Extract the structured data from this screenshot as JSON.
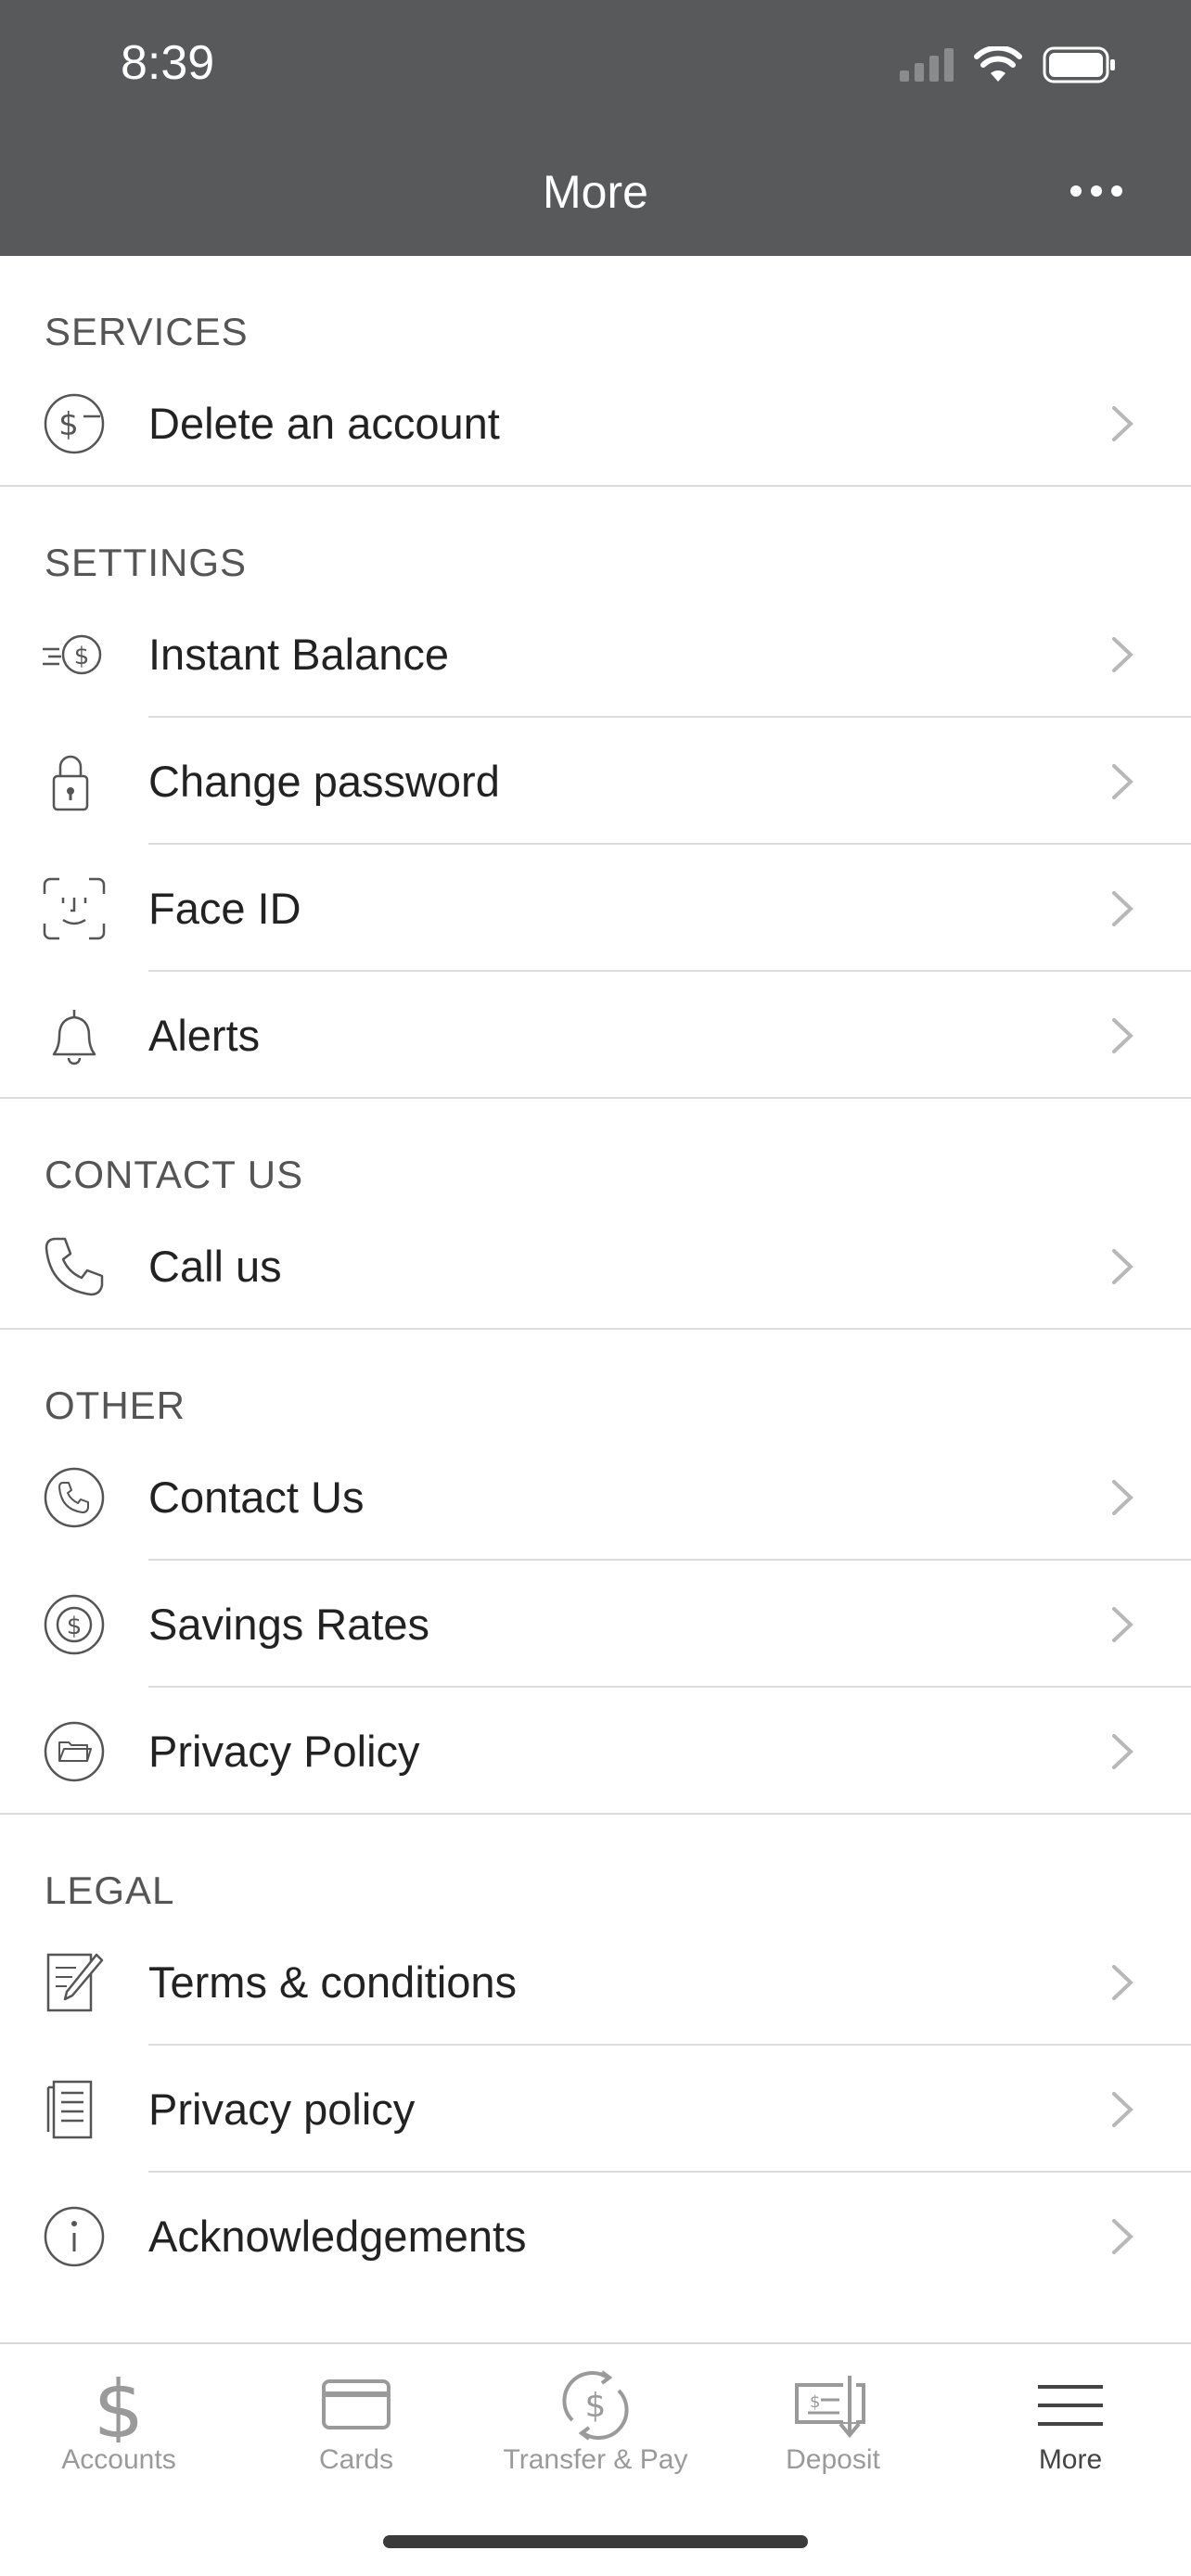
{
  "status_bar": {
    "time": "8:39"
  },
  "nav": {
    "title": "More",
    "more_icon": "ellipsis-icon"
  },
  "sections": {
    "services": {
      "header": "SERVICES",
      "items": [
        {
          "label": "Delete an account",
          "icon": "dollar-minus-icon"
        }
      ]
    },
    "settings": {
      "header": "SETTINGS",
      "items": [
        {
          "label": "Instant Balance",
          "icon": "fast-dollar-icon"
        },
        {
          "label": "Change password",
          "icon": "lock-icon"
        },
        {
          "label": "Face ID",
          "icon": "face-id-icon"
        },
        {
          "label": "Alerts",
          "icon": "bell-icon"
        }
      ]
    },
    "contact": {
      "header": "CONTACT US",
      "items": [
        {
          "label": "Call us",
          "icon": "phone-icon"
        }
      ]
    },
    "other": {
      "header": "OTHER",
      "items": [
        {
          "label": "Contact Us",
          "icon": "phone-circle-icon"
        },
        {
          "label": "Savings Rates",
          "icon": "dollar-circle-icon"
        },
        {
          "label": "Privacy Policy",
          "icon": "folder-circle-icon"
        }
      ]
    },
    "legal": {
      "header": "LEGAL",
      "items": [
        {
          "label": "Terms & conditions",
          "icon": "document-pen-icon"
        },
        {
          "label": "Privacy policy",
          "icon": "document-icon"
        },
        {
          "label": "Acknowledgements",
          "icon": "info-icon"
        }
      ]
    }
  },
  "tabs": [
    {
      "label": "Accounts",
      "icon": "dollar-icon",
      "active": false
    },
    {
      "label": "Cards",
      "icon": "card-icon",
      "active": false
    },
    {
      "label": "Transfer & Pay",
      "icon": "transfer-icon",
      "active": false
    },
    {
      "label": "Deposit",
      "icon": "check-deposit-icon",
      "active": false
    },
    {
      "label": "More",
      "icon": "menu-icon",
      "active": true
    }
  ],
  "colors": {
    "header_bg": "#58595b",
    "text": "#222222",
    "muted": "#9a9a9a",
    "separator": "#dcdcdc"
  }
}
